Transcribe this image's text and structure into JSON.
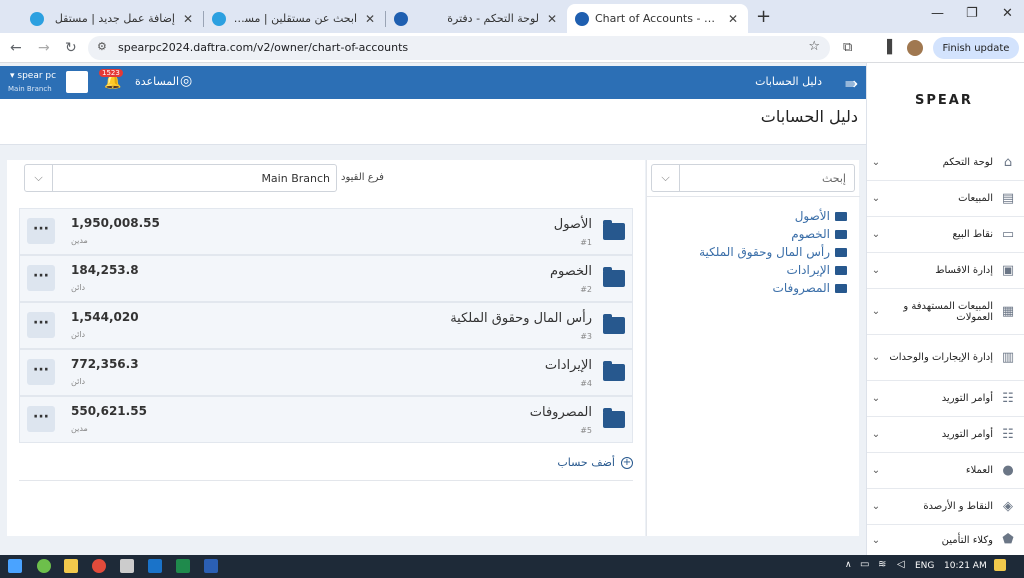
{
  "browser": {
    "tabs": [
      {
        "title": "إضافة عمل جديد | مستقل",
        "active": false
      },
      {
        "title": "ابحث عن مستقلين | مستقل",
        "active": false
      },
      {
        "title": "لوحة التحكم - دفترة",
        "active": false
      },
      {
        "title": "Chart of Accounts - المعلومات",
        "active": true
      }
    ],
    "url": "spearpc2024.daftra.com/v2/owner/chart-of-accounts",
    "finish_update": "Finish update"
  },
  "topbar": {
    "title": "دليل الحسابات",
    "help": "المساعدة",
    "notif_count": "1523",
    "company": "spear pc",
    "branch": "Main Branch"
  },
  "header": {
    "page_title": "دليل الحسابات"
  },
  "filters": {
    "search_placeholder": "إبحث",
    "branch_label": "فرع القيود",
    "branch_value": "Main Branch"
  },
  "accounts": [
    {
      "name": "الأصول",
      "code": "#1",
      "amount": "1,950,008.55",
      "nature": "مدين"
    },
    {
      "name": "الخصوم",
      "code": "#2",
      "amount": "184,253.8",
      "nature": "دائن"
    },
    {
      "name": "رأس المال وحقوق الملكية",
      "code": "#3",
      "amount": "1,544,020",
      "nature": "دائن"
    },
    {
      "name": "الإيرادات",
      "code": "#4",
      "amount": "772,356.3",
      "nature": "دائن"
    },
    {
      "name": "المصروفات",
      "code": "#5",
      "amount": "550,621.55",
      "nature": "مدين"
    }
  ],
  "add_account": "أضف حساب",
  "tree": [
    "الأصول",
    "الخصوم",
    "رأس المال وحقوق الملكية",
    "الإيرادات",
    "المصروفات"
  ],
  "sidebar": {
    "logo": "SPEAR",
    "items": [
      {
        "label": "لوحة التحكم",
        "icon": "home-icon"
      },
      {
        "label": "المبيعات",
        "icon": "receipt-icon"
      },
      {
        "label": "نقاط البيع",
        "icon": "monitor-icon"
      },
      {
        "label": "إدارة الاقساط",
        "icon": "card-icon"
      },
      {
        "label": "المبيعات المستهدفة و العمولات",
        "icon": "money-icon"
      },
      {
        "label": "إدارة الإيجارات والوحدات",
        "icon": "building-icon"
      },
      {
        "label": "أوامر التوريد",
        "icon": "clipboard-icon"
      },
      {
        "label": "أوامر التوريد",
        "icon": "clipboard-icon"
      },
      {
        "label": "العملاء",
        "icon": "user-icon"
      },
      {
        "label": "النقاط و الأرصدة",
        "icon": "layers-icon"
      },
      {
        "label": "وكلاء التأمين",
        "icon": "shield-icon"
      }
    ]
  },
  "taskbar": {
    "lang": "ENG",
    "time": "10:21 AM"
  }
}
